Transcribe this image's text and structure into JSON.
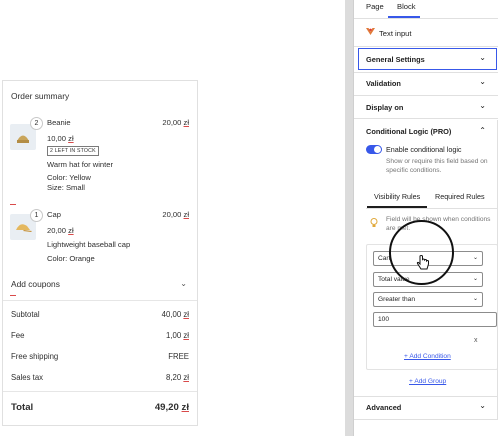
{
  "order": {
    "title": "Order summary",
    "items": [
      {
        "qty": "2",
        "name": "Beanie",
        "price": "20,00",
        "unit_price": "10,00",
        "stock_badge": "2 LEFT IN STOCK",
        "description": "Warm hat for winter",
        "attr1": "Color: Yellow",
        "attr2": "Size: Small"
      },
      {
        "qty": "1",
        "name": "Cap",
        "price": "20,00",
        "unit_price": "20,00",
        "description": "Lightweight baseball cap",
        "attr1": "Color: Orange"
      }
    ],
    "currency": "zł",
    "coupons_label": "Add coupons",
    "rows": [
      {
        "label": "Subtotal",
        "value": "40,00",
        "currency": true
      },
      {
        "label": "Fee",
        "value": "1,00",
        "currency": true
      },
      {
        "label": "Free shipping",
        "value": "FREE",
        "currency": false
      },
      {
        "label": "Sales tax",
        "value": "8,20",
        "currency": true
      }
    ],
    "total_label": "Total",
    "total_value": "49,20"
  },
  "panel": {
    "tabs": [
      "Page",
      "Block"
    ],
    "active_tab": "Block",
    "block_name": "Text input",
    "sections": {
      "general": "General Settings",
      "validation": "Validation",
      "display_on": "Display on",
      "conditional": "Conditional Logic (PRO)",
      "advanced": "Advanced"
    },
    "enable_label": "Enable conditional logic",
    "enable_on": true,
    "enable_help": "Show or require this field based on specific conditions.",
    "rule_tabs": [
      "Visibility Rules",
      "Required Rules"
    ],
    "active_rule_tab": "Visibility Rules",
    "note": "Field will be shown when conditions are met.",
    "condition": {
      "field": "Cart",
      "property": "Total value",
      "operator": "Greater than",
      "value": "100"
    },
    "remove_symbol": "x",
    "add_condition": "+ Add Condition",
    "add_group": "+ Add Group"
  },
  "icons": {
    "block": "text-input-logo-icon",
    "bulb": "lightbulb-icon",
    "cursor": "hand-pointer-icon"
  },
  "colors": {
    "accent": "#3858e9",
    "underline_mark": "#d94a4a"
  }
}
